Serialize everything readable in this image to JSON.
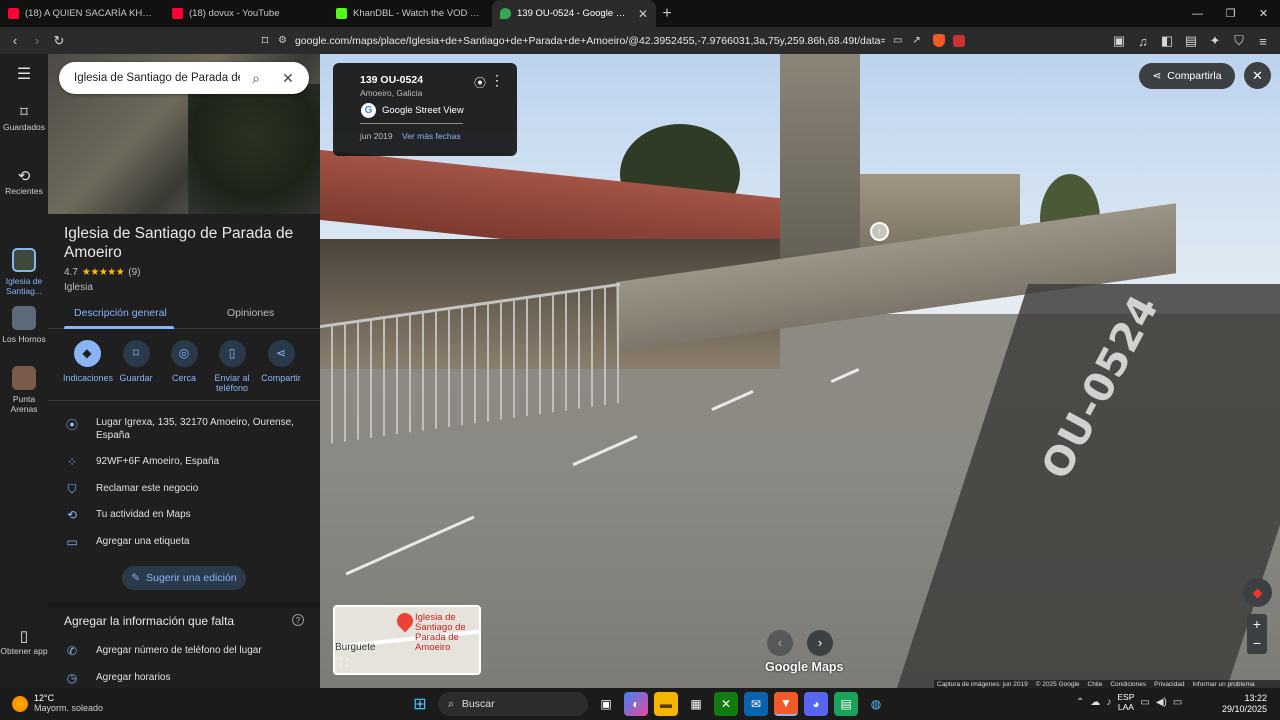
{
  "browser": {
    "tabs": [
      {
        "title": "(18) A QUIEN SACARÍA KHAN DE LA",
        "favicon_color": "#ff0033",
        "active": false
      },
      {
        "title": "(18) dovux - YouTube",
        "favicon_color": "#ff0033",
        "active": false
      },
      {
        "title": "KhanDBL - Watch the VOD on Kick",
        "favicon_color": "#53fc18",
        "active": false
      },
      {
        "title": "139 OU-0524 - Google Maps",
        "favicon_color": "#34a853",
        "active": true
      }
    ],
    "new_tab": "+",
    "url": "google.com/maps/place/Iglesia+de+Santiago+de+Parada+de+Amoeiro/@42.3952455,-7.9766031,3a,75y,259.86h,68.49t/data=!3m7!1e1!3m5!1"
  },
  "rail": {
    "saved": "Guardados",
    "recent": "Recientes",
    "recent_items": [
      {
        "label": "Iglesia de Santiag...",
        "color": "#3f4a3a"
      },
      {
        "label": "Los Hornos",
        "color": "#5c6b7a"
      },
      {
        "label": "Punta Arenas",
        "color": "#7a5a4a"
      }
    ],
    "get_app": "Obtener app"
  },
  "search": {
    "value": "Iglesia de Santiago de Parada de Am"
  },
  "place": {
    "title": "Iglesia de Santiago de Parada de Amoeiro",
    "rating": "4.7",
    "stars": "★★★★★",
    "review_count": "(9)",
    "type": "Iglesia",
    "tabs": [
      "Descripción general",
      "Opiniones"
    ],
    "actions": [
      "Indicaciones",
      "Guardar",
      "Cerca",
      "Enviar al teléfono",
      "Compartir"
    ],
    "address": "Lugar Igrexa, 135, 32170 Amoeiro, Ourense, España",
    "plus_code": "92WF+6F Amoeiro, España",
    "claim": "Reclamar este negocio",
    "activity": "Tu actividad en Maps",
    "label": "Agregar una etiqueta",
    "suggest_edit": "Sugerir una edición",
    "missing_title": "Agregar la información que falta",
    "add_phone": "Agregar número de teléfono del lugar",
    "add_hours": "Agregar horarios"
  },
  "streetview": {
    "card_title": "139 OU-0524",
    "card_sub": "Amoeiro, Galicia",
    "card_service": "Google Street View",
    "card_date": "jun 2019",
    "card_more": "Ver más fechas",
    "share": "Compartirla",
    "road_text": "OU-0524",
    "logo": "Google Maps",
    "minimap_place": "Iglesia de Santiago de Parada de Amoeiro",
    "minimap_town": "Burguete",
    "attribution": [
      "Captura de imágenes: jun 2019",
      "© 2025 Google",
      "Chile",
      "Condiciones",
      "Privacidad",
      "Informar un problema"
    ]
  },
  "taskbar": {
    "temp": "12°C",
    "weather": "Mayorm. soleado",
    "search": "Buscar",
    "lang_1": "ESP",
    "lang_2": "LAA",
    "time": "13:22",
    "date": "29/10/2025"
  }
}
